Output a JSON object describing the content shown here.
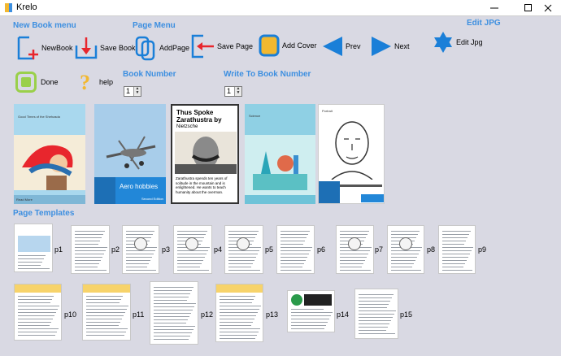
{
  "window": {
    "title": "Krelo"
  },
  "sections": {
    "new_book_menu": "New Book menu",
    "page_menu": "Page Menu",
    "edit_jpg": "Edit JPG",
    "book_number": "Book Number",
    "write_to_book_number": "Write To Book Number",
    "page_templates": "Page Templates"
  },
  "toolbar": {
    "new_book": "NewBook",
    "save_book": "Save Book",
    "add_page": "AddPage",
    "save_page": "Save Page",
    "add_cover": "Add Cover",
    "prev": "Prev",
    "next": "Next",
    "edit_jpg": "Edit Jpg",
    "done": "Done",
    "help": "help"
  },
  "spinners": {
    "book_number": "1",
    "write_to_book_number": "1"
  },
  "covers": {
    "c1": {
      "heading": "Good Times of the Shehzada",
      "footer": "Read More"
    },
    "c2": {
      "heading": "Aero hobbies",
      "sub": "Second Edition"
    },
    "c3": {
      "title": "Thus Spoke Zarathustra by",
      "author": "Nietzsche",
      "blurb": "Zarathustra spends ten years of solitude in the mountain and is enlightened. He wants to teach humanity about the overman."
    },
    "c4": {
      "heading": "Science"
    },
    "c5": {
      "heading": "Portrait"
    }
  },
  "templates": [
    "p1",
    "p2",
    "p3",
    "p4",
    "p5",
    "p6",
    "p7",
    "p8",
    "p9",
    "p10",
    "p11",
    "p12",
    "p13",
    "p14",
    "p15"
  ],
  "colors": {
    "accent": "#3d8fe0",
    "icon_blue": "#1a7fd8",
    "red": "#e8262d",
    "done_green": "#9ad04a"
  }
}
